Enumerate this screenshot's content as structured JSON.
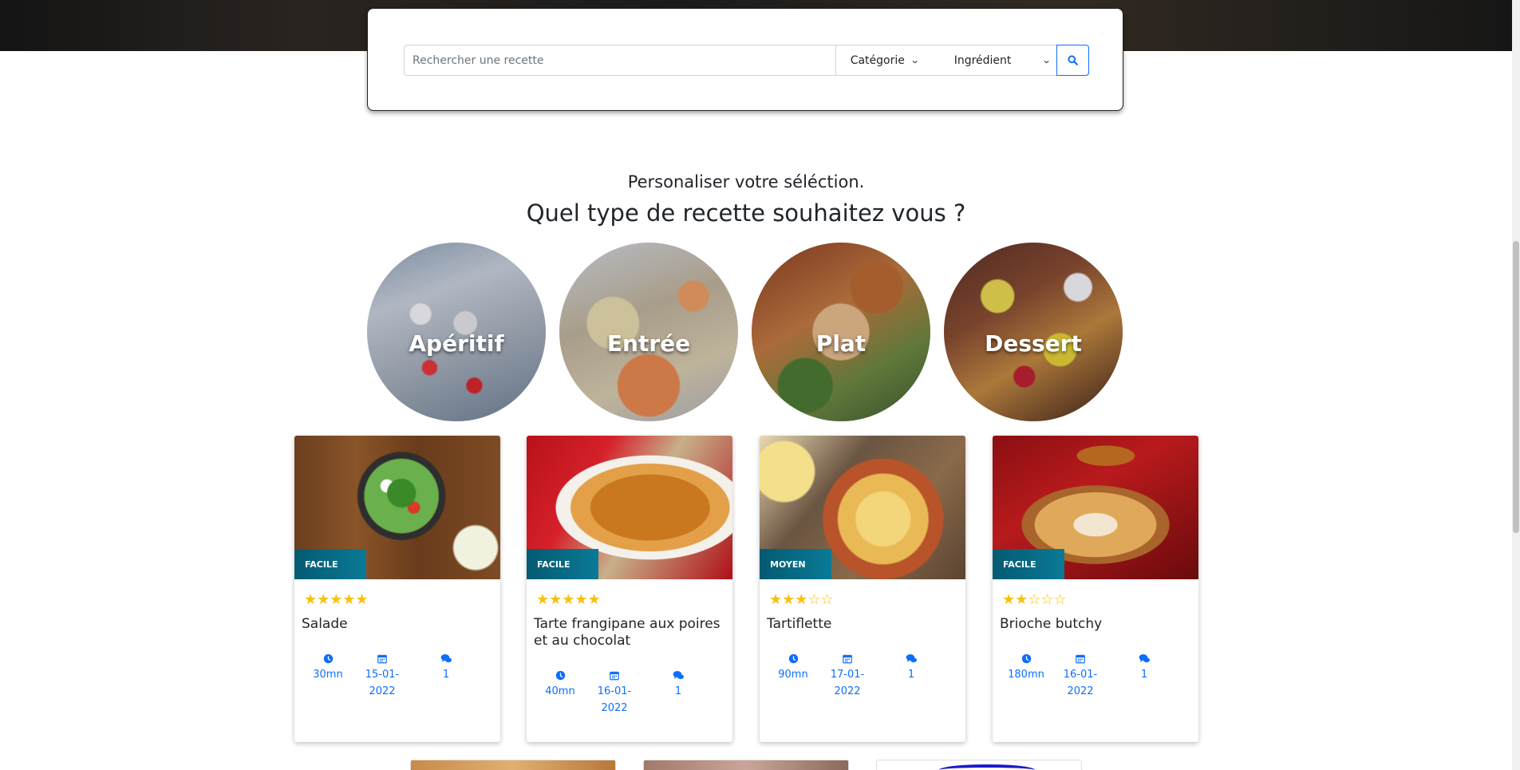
{
  "search": {
    "placeholder": "Rechercher une recette",
    "category_label": "Catégorie",
    "ingredient_label": "Ingrédient"
  },
  "section": {
    "subtitle": "Personaliser votre séléction.",
    "heading": "Quel type de recette souhaitez vous ?"
  },
  "categories": [
    {
      "label": "Apéritif"
    },
    {
      "label": "Entrée"
    },
    {
      "label": "Plat"
    },
    {
      "label": "Dessert"
    }
  ],
  "recipes": [
    {
      "title": "Salade",
      "difficulty": "FACILE",
      "rating": 5,
      "time": "30mn",
      "date": "15-01-2022",
      "comments": "1"
    },
    {
      "title": "Tarte frangipane aux poires et au chocolat",
      "difficulty": "FACILE",
      "rating": 5,
      "time": "40mn",
      "date": "16-01-2022",
      "comments": "1"
    },
    {
      "title": "Tartiflette",
      "difficulty": "MOYEN",
      "rating": 3,
      "time": "90mn",
      "date": "17-01-2022",
      "comments": "1"
    },
    {
      "title": "Brioche butchy",
      "difficulty": "FACILE",
      "rating": 2,
      "time": "180mn",
      "date": "16-01-2022",
      "comments": "1"
    }
  ],
  "colors": {
    "accent": "#0d6efd",
    "star": "#f5c20c",
    "badge": "#066a85"
  },
  "icons": {
    "search": "search-icon",
    "time": "clock-icon",
    "date": "calendar-icon",
    "comments": "comments-icon"
  }
}
